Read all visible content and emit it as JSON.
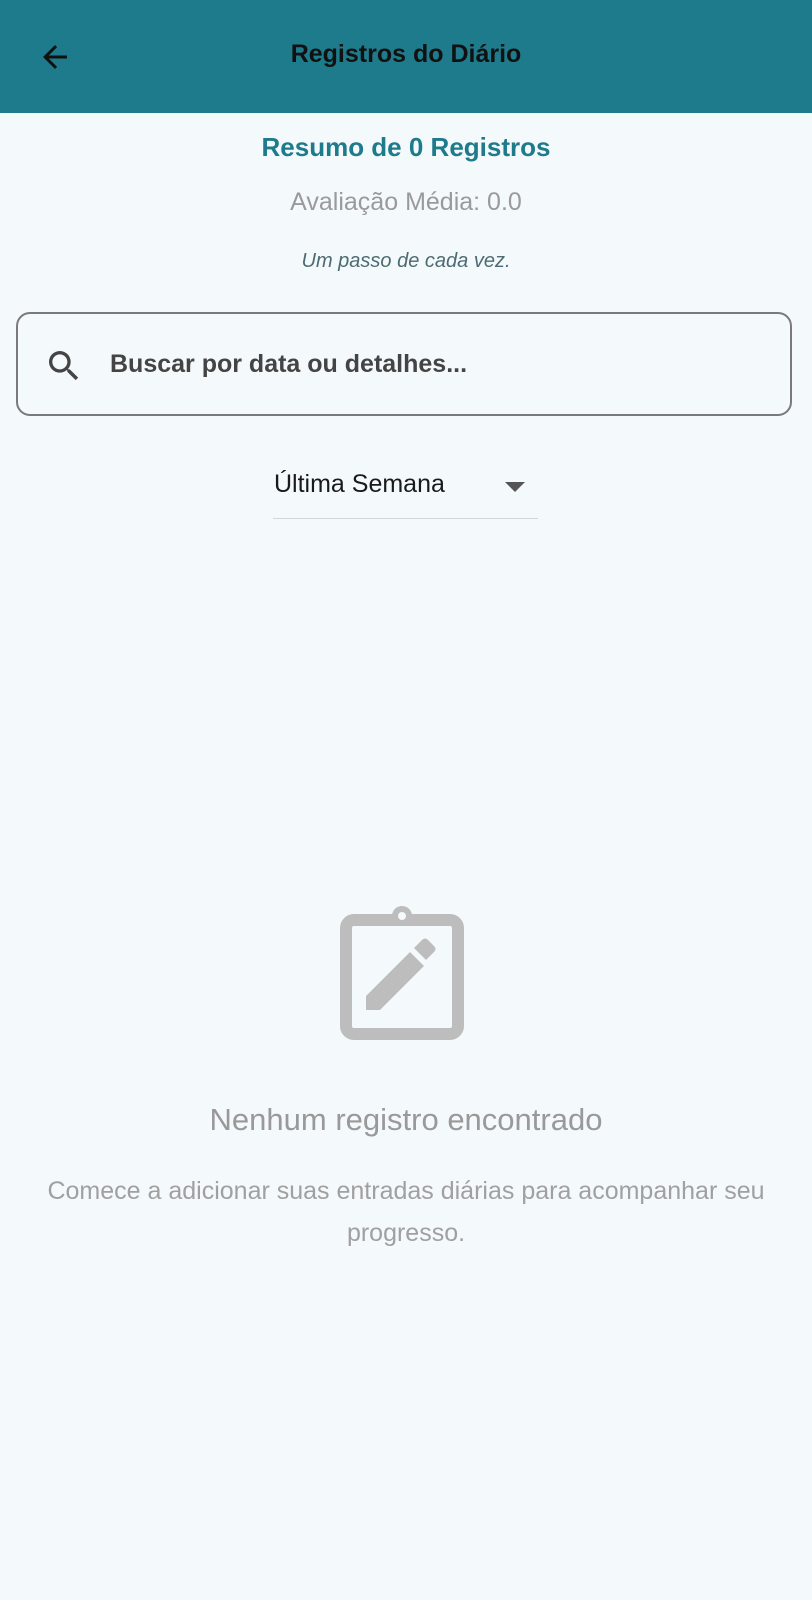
{
  "header": {
    "title": "Registros do Diário",
    "back_icon": "arrow-left-icon",
    "background_color": "#1e7b8c"
  },
  "summary": {
    "title": "Resumo de 0 Registros",
    "average_rating": "Avaliação Média: 0.0",
    "motto": "Um passo de cada vez."
  },
  "search": {
    "icon": "search-icon",
    "placeholder": "Buscar por data ou detalhes...",
    "value": ""
  },
  "filter": {
    "selected": "Última Semana",
    "icon": "chevron-down-icon"
  },
  "empty_state": {
    "icon": "clipboard-edit-icon",
    "title": "Nenhum registro encontrado",
    "description": "Comece a adicionar suas entradas diárias para acompanhar seu progresso."
  }
}
